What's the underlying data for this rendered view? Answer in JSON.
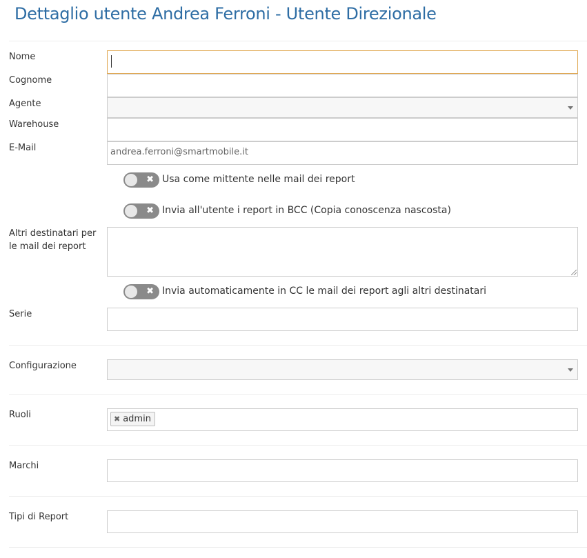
{
  "page": {
    "title": "Dettaglio utente Andrea Ferroni - Utente Direzionale"
  },
  "form": {
    "nome": {
      "label": "Nome",
      "value": ""
    },
    "cognome": {
      "label": "Cognome",
      "value": ""
    },
    "agente": {
      "label": "Agente",
      "value": ""
    },
    "warehouse": {
      "label": "Warehouse",
      "value": ""
    },
    "email": {
      "label": "E-Mail",
      "value": "andrea.ferroni@smartmobile.it"
    },
    "toggle_mittente": {
      "label": "Usa come mittente nelle mail dei report",
      "on": false,
      "off_glyph": "✖"
    },
    "toggle_bcc": {
      "label": "Invia all'utente i report in BCC (Copia conoscenza nascosta)",
      "on": false,
      "off_glyph": "✖"
    },
    "altri_destinatari": {
      "label_line1": "Altri destinatari per",
      "label_line2": "le mail dei report",
      "value": ""
    },
    "toggle_cc": {
      "label": "Invia automaticamente in CC le mail dei report agli altri destinatari",
      "on": false,
      "off_glyph": "✖"
    },
    "serie": {
      "label": "Serie",
      "value": ""
    },
    "configurazione": {
      "label": "Configurazione",
      "value": ""
    },
    "ruoli": {
      "label": "Ruoli",
      "tags": [
        {
          "text": "admin",
          "remove_glyph": "✖"
        }
      ]
    },
    "marchi": {
      "label": "Marchi",
      "value": ""
    },
    "tipi_report": {
      "label": "Tipi di Report",
      "value": ""
    }
  },
  "icons": {
    "select_arrow": "caret-down-icon",
    "toggle_off": "close-icon",
    "tag_remove": "close-icon"
  },
  "colors": {
    "title": "#2e6da4",
    "focus_border": "#e0a852",
    "toggle_off_bg": "#8a8a8a",
    "border": "#cccccc"
  }
}
